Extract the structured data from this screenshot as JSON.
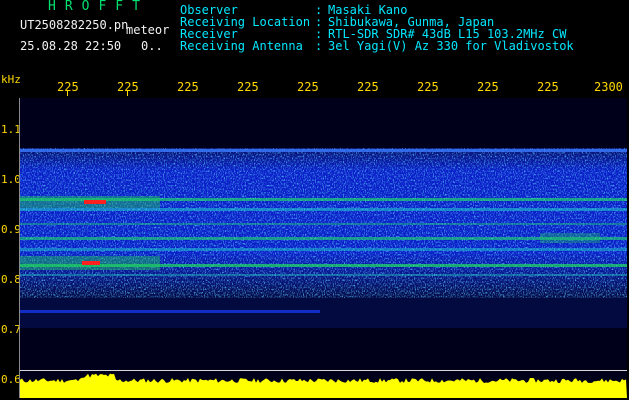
{
  "app": {
    "title": "HROFFT"
  },
  "file": {
    "name": "UT2508282250.pn",
    "mode": "meteor",
    "datetime": "25.08.28 22:50",
    "page": "0.."
  },
  "info": [
    {
      "label": "Observer",
      "value": "Masaki Kano"
    },
    {
      "label": "Receiving Location",
      "value": "Shibukawa, Gunma, Japan"
    },
    {
      "label": "Receiver",
      "value": "RTL-SDR SDR# 43dB L15 103.2MHz CW"
    },
    {
      "label": "Receiving Antenna",
      "value": "3el Yagi(V) Az 330 for Vladivostok"
    }
  ],
  "axis": {
    "unit": "kHz",
    "time_ticks": [
      "225",
      "225",
      "225",
      "225",
      "225",
      "225",
      "225",
      "225",
      "225",
      "2300"
    ],
    "freq_ticks": [
      "1.1",
      "1.0",
      "0.9",
      "0.8",
      "0.7",
      "0.6"
    ]
  },
  "colors": {
    "info_text": "#00e8ff",
    "file_text": "#f2f2f2",
    "title_text": "#00e070",
    "tick_text": "#ffd800",
    "signal_yellow": "#ffff00",
    "waterfall_blue": "#0a1ec8",
    "echo_green": "#22ff55",
    "echo_red": "#ff2020"
  }
}
